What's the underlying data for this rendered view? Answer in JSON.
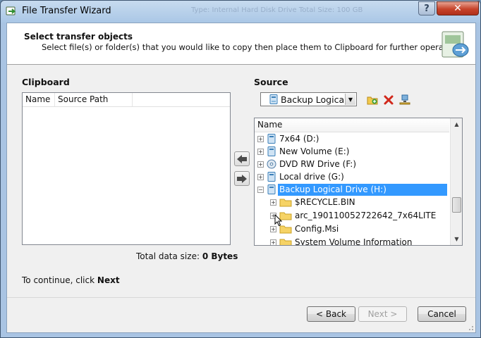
{
  "window": {
    "title": "File Transfer Wizard",
    "background_text": "Type: Internal Hard Disk Drive   Total Size: 100 GB",
    "help_label": "?",
    "close_label": "✕"
  },
  "header": {
    "title": "Select transfer objects",
    "subtitle": "Select file(s) or folder(s) that you would like to copy then place them to Clipboard for further operations."
  },
  "clipboard": {
    "label": "Clipboard",
    "columns": [
      "Name",
      "Source Path"
    ]
  },
  "source": {
    "label": "Source",
    "selected": "Backup Logical Drive (H:)",
    "tree_header": "Name",
    "items": [
      {
        "label": "7x64 (D:)",
        "icon": "drive-icon"
      },
      {
        "label": "New Volume (E:)",
        "icon": "drive-icon"
      },
      {
        "label": "DVD RW Drive (F:)",
        "icon": "dvd-drive-icon"
      },
      {
        "label": "Local drive (G:)",
        "icon": "drive-icon"
      },
      {
        "label": "Backup Logical Drive (H:)",
        "icon": "drive-icon"
      },
      {
        "label": "$RECYCLE.BIN",
        "icon": "folder-icon"
      },
      {
        "label": "arc_190110052722642_7x64LITE",
        "icon": "folder-icon"
      },
      {
        "label": "Config.Msi",
        "icon": "folder-icon"
      },
      {
        "label": "System Volume Information",
        "icon": "folder-icon"
      }
    ]
  },
  "summary": {
    "total_label": "Total data size:",
    "total_value": "0 Bytes",
    "continue_prefix": "To continue, click",
    "continue_next": "Next"
  },
  "buttons": {
    "back": "< Back",
    "next": "Next >",
    "cancel": "Cancel"
  },
  "colors": {
    "selection": "#3399ff",
    "close_button": "#c7432a",
    "title_bar": "#aac7e6"
  }
}
